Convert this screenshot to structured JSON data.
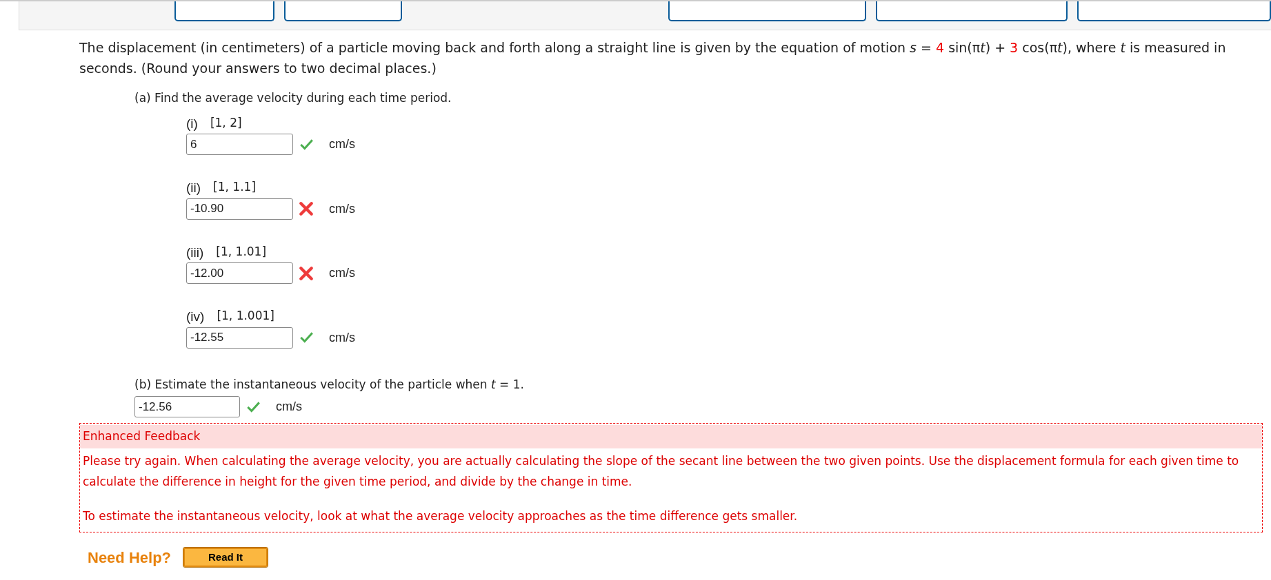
{
  "header_buttons": [
    {
      "kind": "outlined"
    },
    {
      "kind": "outlined"
    },
    {
      "kind": "gap"
    },
    {
      "kind": "outlined"
    },
    {
      "kind": "outlined"
    },
    {
      "kind": "outlined"
    }
  ],
  "question": {
    "lead": "The displacement (in centimeters) of a particle moving back and forth along a straight line is given by the equation of motion ",
    "equation": [
      {
        "text": "s",
        "kind": "variable"
      },
      {
        "text": " = ",
        "kind": "plain"
      },
      {
        "text": "4",
        "kind": "coefficient"
      },
      {
        "text": " sin(π",
        "kind": "plain"
      },
      {
        "text": "t",
        "kind": "variable"
      },
      {
        "text": ") + ",
        "kind": "plain"
      },
      {
        "text": "3",
        "kind": "coefficient"
      },
      {
        "text": " cos(π",
        "kind": "plain"
      },
      {
        "text": "t",
        "kind": "variable"
      },
      {
        "text": "),",
        "kind": "plain"
      }
    ],
    "tail": " where *t* is measured in seconds. (Round your answers to two decimal places.)"
  },
  "part_a": {
    "prompt": "(a) Find the average velocity during each time period.",
    "items": [
      {
        "label": "(i)",
        "interval": "[1, 2]",
        "value": "6",
        "correct": true,
        "unit": "cm/s"
      },
      {
        "label": "(ii)",
        "interval": "[1, 1.1]",
        "value": "-10.90",
        "correct": false,
        "unit": "cm/s"
      },
      {
        "label": "(iii)",
        "interval": "[1, 1.01]",
        "value": "-12.00",
        "correct": false,
        "unit": "cm/s"
      },
      {
        "label": "(iv)",
        "interval": "[1, 1.001]",
        "value": "-12.55",
        "correct": true,
        "unit": "cm/s"
      }
    ]
  },
  "part_b": {
    "prompt": "(b) Estimate the instantaneous velocity of the particle when *t* = 1.",
    "value": "-12.56",
    "correct": true,
    "unit": "cm/s"
  },
  "feedback": {
    "title": "Enhanced Feedback",
    "paragraphs": [
      "Please try again. When calculating the average velocity, you are actually calculating the slope of the secant line between the two given points. Use the displacement formula for each given time to calculate the difference in height for the given time period, and divide by the change in time.",
      "To estimate the instantaneous velocity, look at what the average velocity approaches as the time difference gets smaller."
    ]
  },
  "help": {
    "label": "Need Help?",
    "buttons": [
      "Read It"
    ]
  }
}
